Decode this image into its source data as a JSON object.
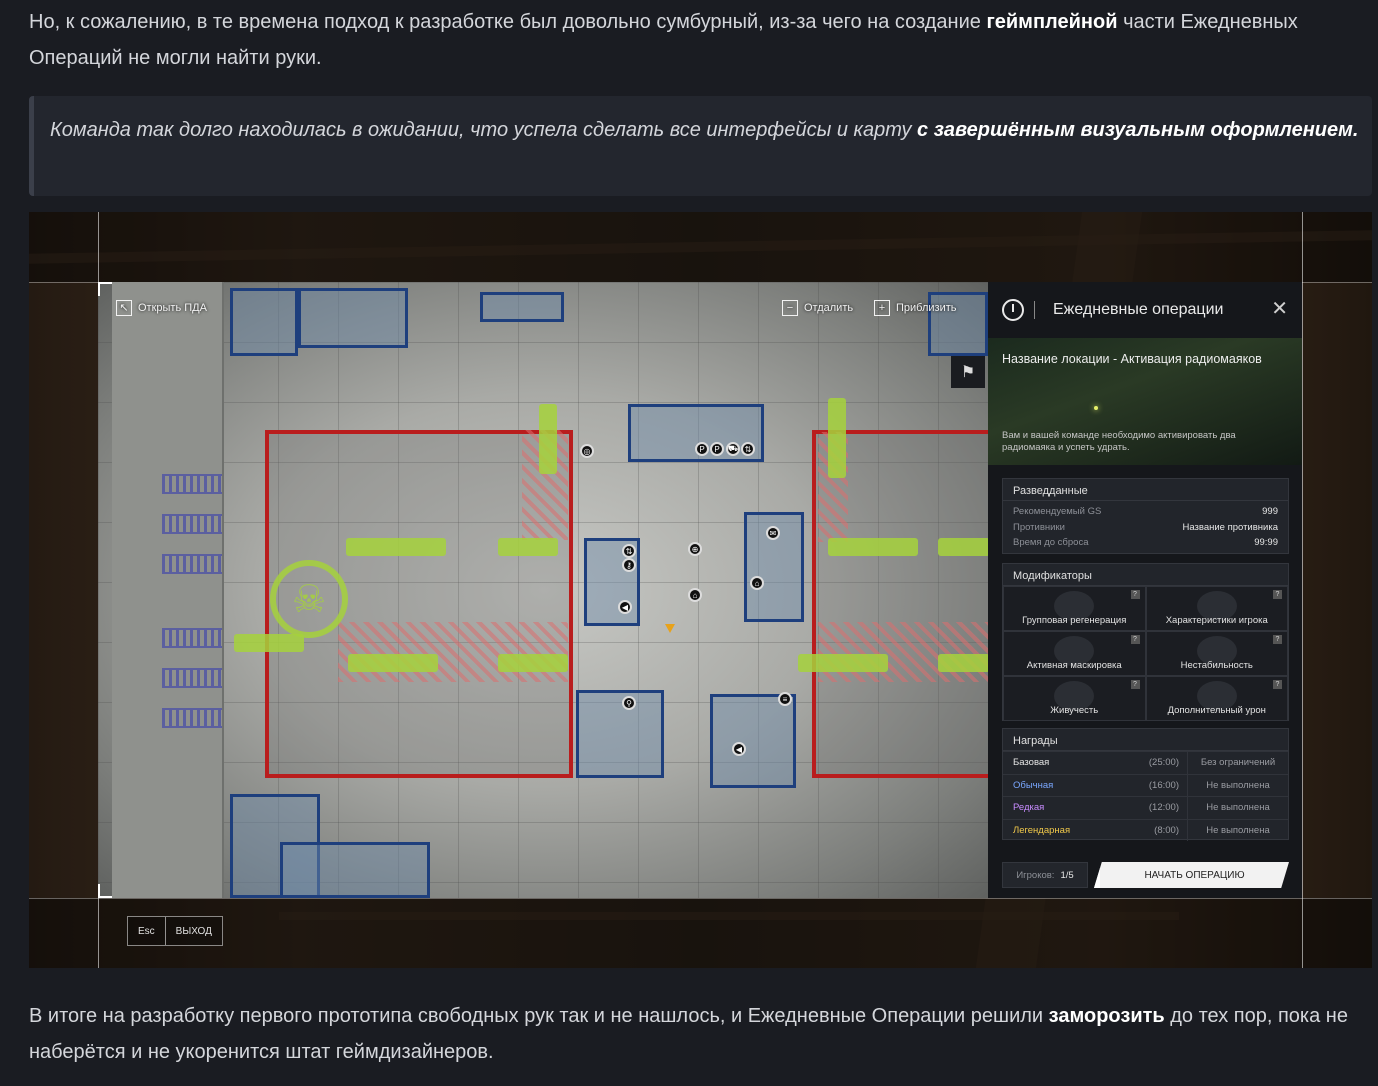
{
  "article": {
    "p1_a": "Но, к сожалению, в те времена подход к разработке был довольно сумбурный, из-за чего на создание ",
    "p1_b": "геймплейной",
    "p1_c": " части Ежедневных Операций не могли найти руки.",
    "quote_a": "Команда так долго находилась в ожидании, что успела сделать все интерфейсы и карту ",
    "quote_b": "с завершённым визуальным оформлением.",
    "p2_a": "В итоге на разработку первого прототипа свободных рук так и не нашлось, и Ежедневные Операции решили ",
    "p2_b": "заморозить",
    "p2_c": " до тех пор, пока не наберётся и не укоренится штат геймдизайнеров."
  },
  "game": {
    "open_pda": "Открыть ПДА",
    "zoom_out": "Отдалить",
    "zoom_in": "Приблизить",
    "esc_key": "Esc",
    "exit": "ВЫХОД",
    "panel": {
      "title": "Ежедневные операции",
      "location_title": "Название локации - Активация радиомаяков",
      "location_desc": "Вам и вашей команде необходимо активировать два радиомаяка и успеть удрать.",
      "intel": {
        "title": "Разведданные",
        "rows": [
          {
            "k": "Рекомендуемый GS",
            "v": "999"
          },
          {
            "k": "Противники",
            "v": "Название противника"
          },
          {
            "k": "Время до сброса",
            "v": "99:99"
          }
        ]
      },
      "modifiers": {
        "title": "Модификаторы",
        "items": [
          "Групповая регенерация",
          "Характеристики игрока",
          "Активная маскировка",
          "Нестабильность",
          "Живучесть",
          "Дополнительный урон"
        ]
      },
      "rewards": {
        "title": "Награды",
        "rows": [
          {
            "name": "Базовая",
            "time": "(25:00)",
            "status": "Без ограничений",
            "color": "#e6e6e6"
          },
          {
            "name": "Обычная",
            "time": "(16:00)",
            "status": "Не выполнена",
            "color": "#7aa7ff"
          },
          {
            "name": "Редкая",
            "time": "(12:00)",
            "status": "Не выполнена",
            "color": "#c88cff"
          },
          {
            "name": "Легендарная",
            "time": "(8:00)",
            "status": "Не выполнена",
            "color": "#f0c84a"
          }
        ]
      },
      "players_label": "Игроков:",
      "players_value": "1/5",
      "start_button": "НАЧАТЬ ОПЕРАЦИЮ"
    }
  }
}
